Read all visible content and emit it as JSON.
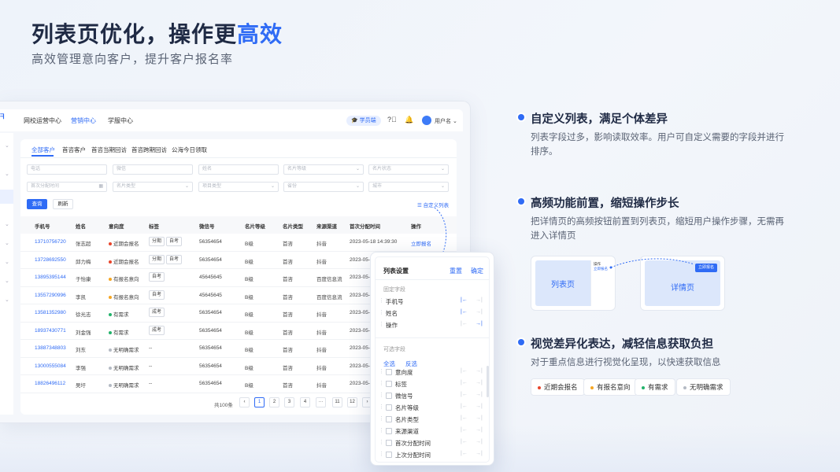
{
  "hero": {
    "title_part1": "列表页优化，操作更",
    "title_highlight": "高效",
    "subtitle": "高效管理意向客户，提升客户报名率"
  },
  "app": {
    "logo_fragment": "ᖷ",
    "nav": [
      "网校运营中心",
      "营销中心",
      "学服中心"
    ],
    "vip_label": "学员端",
    "username": "用户名",
    "tabs": [
      "全部客户",
      "首咨客户",
      "首咨当期回访",
      "首咨跨期回访",
      "公海今日领取"
    ],
    "filters_row1": [
      "电话",
      "微信",
      "姓名",
      "名片等级",
      "名片状态"
    ],
    "filters_row2": [
      "首次分配时间",
      "名片类型",
      "项目类型",
      "省份",
      "城市"
    ],
    "query_btn": "查询",
    "refresh_btn": "刷新",
    "custom_list": "自定义列表",
    "columns": [
      "手机号",
      "姓名",
      "意向度",
      "标签",
      "微信号",
      "名片等级",
      "名片类型",
      "来源渠道",
      "首次分配时间",
      "操作"
    ],
    "rows": [
      {
        "phone": "13710756720",
        "name": "张志超",
        "intent": "近期会报名",
        "tags": [
          "分期",
          "自考"
        ],
        "wechat": "56354654",
        "level": "B级",
        "type": "首咨",
        "source": "抖音",
        "time": "2023-05-18 14:39:30",
        "op": "立即报名"
      },
      {
        "phone": "13728692550",
        "name": "邱力梅",
        "intent": "近期会报名",
        "tags": [
          "分期",
          "自考"
        ],
        "wechat": "56354654",
        "level": "B级",
        "type": "首咨",
        "source": "抖音",
        "time": "2023-05-",
        "op": ""
      },
      {
        "phone": "13895395144",
        "name": "于怡康",
        "intent": "有报名意向",
        "tags": [
          "自考"
        ],
        "wechat": "45645645",
        "level": "B级",
        "type": "首咨",
        "source": "百度信息流",
        "time": "2023-05-",
        "op": ""
      },
      {
        "phone": "13557290996",
        "name": "李凯",
        "intent": "有报名意向",
        "tags": [
          "自考"
        ],
        "wechat": "45645645",
        "level": "B级",
        "type": "首咨",
        "source": "百度信息流",
        "time": "2023-05-",
        "op": ""
      },
      {
        "phone": "13581352980",
        "name": "徐光志",
        "intent": "有需求",
        "tags": [
          "成考"
        ],
        "wechat": "56354654",
        "level": "B级",
        "type": "首咨",
        "source": "抖音",
        "time": "2023-05-",
        "op": ""
      },
      {
        "phone": "18937430771",
        "name": "刘金强",
        "intent": "有需求",
        "tags": [
          "成考"
        ],
        "wechat": "56354654",
        "level": "B级",
        "type": "首咨",
        "source": "抖音",
        "time": "2023-05-",
        "op": ""
      },
      {
        "phone": "13887348803",
        "name": "刘东",
        "intent": "无明确需求",
        "tags": [],
        "tag_placeholder": "--",
        "wechat": "56354654",
        "level": "B级",
        "type": "首咨",
        "source": "抖音",
        "time": "2023-05-",
        "op": ""
      },
      {
        "phone": "13000555084",
        "name": "李强",
        "intent": "无明确需求",
        "tags": [],
        "tag_placeholder": "--",
        "wechat": "56354654",
        "level": "B级",
        "type": "首咨",
        "source": "抖音",
        "time": "2023-05-",
        "op": ""
      },
      {
        "phone": "18826496112",
        "name": "吴圩",
        "intent": "无明确需求",
        "tags": [],
        "tag_placeholder": "--",
        "wechat": "56354654",
        "level": "B级",
        "type": "首咨",
        "source": "抖音",
        "time": "2023-05-",
        "op": ""
      }
    ],
    "pager": {
      "total": "共100条",
      "pages": [
        "‹",
        "1",
        "2",
        "3",
        "4",
        "···",
        "11",
        "12",
        "›"
      ],
      "current": "1"
    }
  },
  "panel": {
    "title": "列表设置",
    "reset": "重置",
    "confirm": "确定",
    "fixed_section": "固定字段",
    "fixed_items": [
      "手机号",
      "姓名",
      "操作"
    ],
    "optional_section": "可选字段",
    "select_all": "全选",
    "invert": "反选",
    "optional_items": [
      "意向度",
      "标签",
      "微信号",
      "名片等级",
      "名片类型",
      "来源渠道",
      "首次分配时间",
      "上次分配时间"
    ]
  },
  "features": [
    {
      "title": "自定义列表，满足个体差异",
      "desc": "列表字段过多，影响读取效率。用户可自定义需要的字段并进行排序。"
    },
    {
      "title": "高频功能前置，缩短操作步长",
      "desc": "把详情页的高频按钮前置到列表页，缩短用户操作步骤，无需再进入详情页"
    },
    {
      "title": "视觉差异化表达，减轻信息获取负担",
      "desc": "对于重点信息进行视觉化呈现，以快速获取信息"
    }
  ],
  "mock": {
    "list_label": "列表页",
    "detail_label": "详情页",
    "col_header": "操作",
    "col_link": "立即报名",
    "detail_btn": "立即报名"
  },
  "chips": [
    "近期会报名",
    "有报名意向",
    "有需求",
    "无明确需求"
  ],
  "colors": {
    "accent": "#2f6bf5",
    "intent_near": "#e8452c",
    "intent_have": "#f5a623",
    "intent_need": "#23b36b",
    "intent_none": "#b4bac4"
  }
}
